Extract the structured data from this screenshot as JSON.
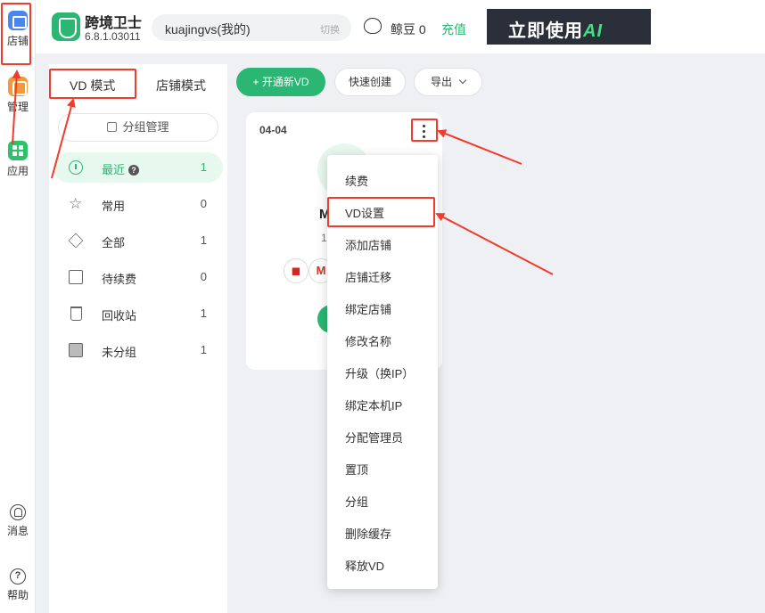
{
  "rail": {
    "items": [
      {
        "label": "店铺"
      },
      {
        "label": "管理"
      },
      {
        "label": "应用"
      }
    ],
    "bottom": [
      {
        "label": "消息"
      },
      {
        "label": "帮助"
      }
    ]
  },
  "header": {
    "app_name": "跨境卫士",
    "version": "6.8.1.03011",
    "account": "kuajingvs(我的)",
    "switch_label": "切换",
    "beans_label": "鲸豆 0",
    "recharge_label": "充值",
    "banner_text": "立即使用",
    "banner_ai": "AI"
  },
  "sidebar": {
    "tabs": [
      {
        "label": "VD 模式"
      },
      {
        "label": "店铺模式"
      }
    ],
    "group_button": "分组管理",
    "items": [
      {
        "label": "最近",
        "count": "1"
      },
      {
        "label": "常用",
        "count": "0"
      },
      {
        "label": "全部",
        "count": "1"
      },
      {
        "label": "待续费",
        "count": "0"
      },
      {
        "label": "回收站",
        "count": "1"
      },
      {
        "label": "未分组",
        "count": "1"
      }
    ]
  },
  "toolbar": {
    "new_vd": "+ 开通新VD",
    "quick_create": "快速创建",
    "export": "导出"
  },
  "card": {
    "date": "04-04",
    "name": "M",
    "number": "1"
  },
  "menu": {
    "items": [
      "续费",
      "VD设置",
      "添加店铺",
      "店铺迁移",
      "绑定店铺",
      "修改名称",
      "升级（换IP）",
      "绑定本机IP",
      "分配管理员",
      "置顶",
      "分组",
      "删除缓存",
      "释放VD"
    ]
  },
  "colors": {
    "accent": "#2bb673",
    "annotation": "#f23a2d",
    "background": "#eef0f3"
  }
}
